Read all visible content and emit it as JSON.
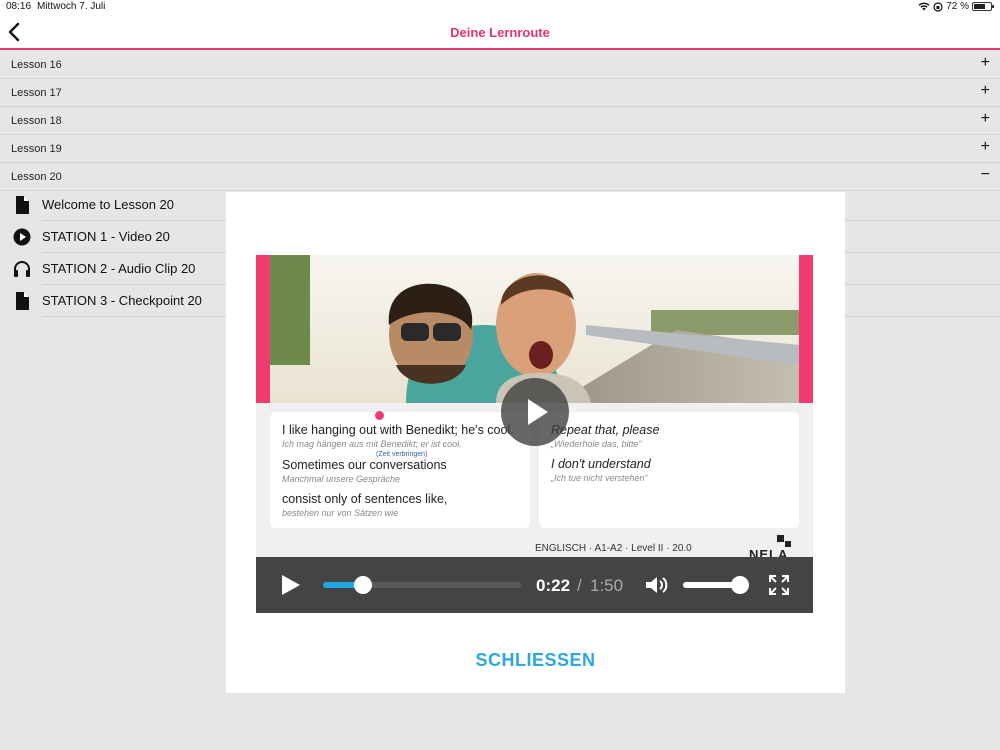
{
  "status_bar": {
    "time": "08:16",
    "date": "Mittwoch 7. Juli",
    "battery": "72 %",
    "battery_level": 0.72
  },
  "header": {
    "title": "Deine Lernroute"
  },
  "lessons": [
    {
      "label": "Lesson 16",
      "toggle": "+"
    },
    {
      "label": "Lesson 17",
      "toggle": "+"
    },
    {
      "label": "Lesson 18",
      "toggle": "+"
    },
    {
      "label": "Lesson 19",
      "toggle": "+"
    },
    {
      "label": "Lesson 20",
      "toggle": "−"
    }
  ],
  "stations": [
    {
      "label": "Welcome to Lesson 20",
      "icon": "document-icon"
    },
    {
      "label": "STATION 1 - Video 20",
      "icon": "play-circle-icon"
    },
    {
      "label": "STATION 2 - Audio Clip 20",
      "icon": "headphones-icon"
    },
    {
      "label": "STATION 3 - Checkpoint 20",
      "icon": "document-icon"
    }
  ],
  "video": {
    "left_panel": {
      "line1_en": "I  like hanging out with Benedikt; he's cool.",
      "line1_de": "Ich mag  hängen     aus    mit    Benedikt;   er ist  cool.",
      "hint": "(Zeit verbringen)",
      "line2_en": "Sometimes our   conversations",
      "line2_de": "Manchmal       unsere        Gespräche",
      "line3_en": "consist   only  of sentences like,",
      "line3_de": "bestehen       nur    von    Sätzen     wie"
    },
    "right_panel": {
      "line1_en": "Repeat        that, please",
      "line1_de": "„Wiederhole          das,     bitte“",
      "line2_en": "I     don't    understand",
      "line2_de": "„Ich  tue nicht       verstehen“"
    },
    "level_text": "ENGLISCH · A1-A2 · Level II · 20.0",
    "logo_text": "NELA",
    "player": {
      "current_time": "0:22",
      "separator": "/",
      "total_time": "1:50",
      "progress": 0.2,
      "volume": 0.95
    }
  },
  "modal": {
    "close_label": "SCHLIESSEN"
  },
  "colors": {
    "accent_pink": "#e8336d",
    "accent_blue": "#2ba8e4"
  }
}
